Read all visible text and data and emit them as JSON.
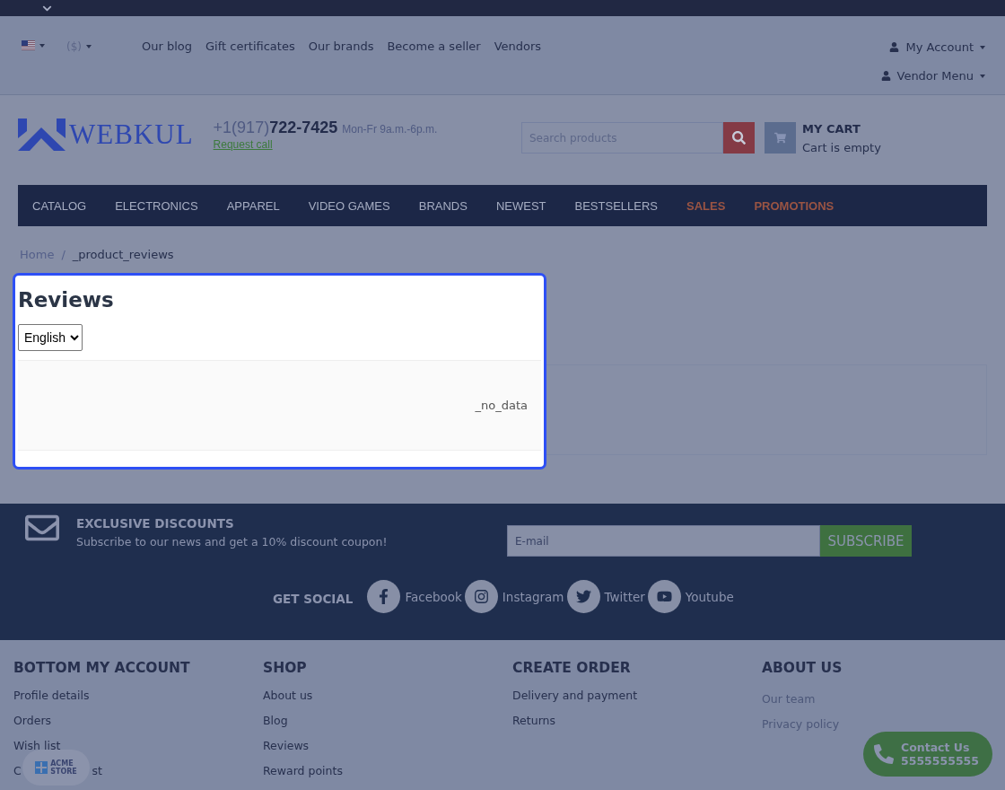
{
  "header": {
    "currency": "($)",
    "links": [
      "Our blog",
      "Gift certificates",
      "Our brands",
      "Become a seller",
      "Vendors"
    ],
    "account_menus": [
      "My Account",
      "Vendor Menu"
    ],
    "logo": "WEBKUL",
    "phone_prefix": "+1(917)",
    "phone_number": "722-7425",
    "hours": "Mon-Fr 9a.m.-6p.m.",
    "request_call": "Request call",
    "search": {
      "placeholder": "Search products"
    },
    "cart": {
      "title": "MY CART",
      "status": "Cart is empty"
    }
  },
  "nav": [
    {
      "label": "CATALOG",
      "kind": "normal"
    },
    {
      "label": "ELECTRONICS",
      "kind": "normal"
    },
    {
      "label": "APPAREL",
      "kind": "normal"
    },
    {
      "label": "VIDEO GAMES",
      "kind": "normal"
    },
    {
      "label": "BRANDS",
      "kind": "normal"
    },
    {
      "label": "NEWEST",
      "kind": "normal"
    },
    {
      "label": "BESTSELLERS",
      "kind": "normal"
    },
    {
      "label": "SALES",
      "kind": "promo"
    },
    {
      "label": "PROMOTIONS",
      "kind": "promo"
    }
  ],
  "breadcrumb": {
    "items": [
      "Home",
      "_product_reviews"
    ],
    "separator": "/"
  },
  "reviews": {
    "title": "Reviews",
    "language": "English",
    "empty_text": "_no_data"
  },
  "newsletter": {
    "title": "EXCLUSIVE DISCOUNTS",
    "text": "Subscribe to our news and get a 10% discount coupon!",
    "email_placeholder": "E-mail",
    "button": "SUBSCRIBE"
  },
  "social": {
    "title": "GET SOCIAL",
    "links": [
      {
        "kind": "facebook",
        "label": "Facebook"
      },
      {
        "kind": "instagram",
        "label": "Instagram"
      },
      {
        "kind": "twitter",
        "label": "Twitter"
      },
      {
        "kind": "youtube",
        "label": "Youtube"
      }
    ]
  },
  "footer_columns": [
    {
      "title": "BOTTOM MY ACCOUNT",
      "links_muted": false,
      "links": [
        {
          "label": "Profile details"
        },
        {
          "label": "Orders"
        },
        {
          "label": "Wish list"
        },
        {
          "parts": [
            "C",
            "st"
          ]
        }
      ]
    },
    {
      "title": "SHOP",
      "links_muted": false,
      "links": [
        {
          "label": "About us"
        },
        {
          "label": "Blog"
        },
        {
          "label": "Reviews"
        },
        {
          "label": "Reward points"
        }
      ]
    },
    {
      "title": "CREATE ORDER",
      "links_muted": false,
      "links": [
        {
          "label": "Delivery and payment"
        },
        {
          "label": "Returns"
        }
      ]
    },
    {
      "title": "ABOUT US",
      "links_muted": true,
      "links": [
        {
          "label": "Our team"
        },
        {
          "label": "Privacy policy"
        }
      ]
    }
  ],
  "store_badge": {
    "line1": "ACME",
    "line2": "STORE"
  },
  "contact_button": {
    "label": "Contact Us",
    "phone": "5555555555"
  }
}
